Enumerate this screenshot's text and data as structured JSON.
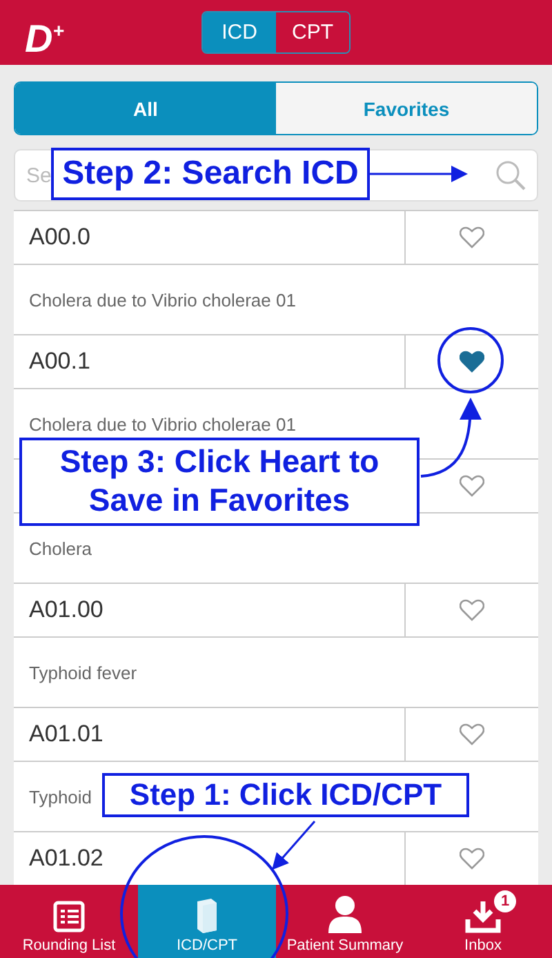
{
  "header": {
    "logo": "D$^{+}$",
    "segments": [
      {
        "label": "ICD",
        "selected": true
      },
      {
        "label": "CPT",
        "selected": false
      }
    ]
  },
  "tabs": [
    {
      "label": "All",
      "selected": true
    },
    {
      "label": "Favorites",
      "selected": false
    }
  ],
  "search": {
    "placeholder": "Se"
  },
  "entries": [
    {
      "code": "A00.0",
      "favorite": false,
      "description": "Cholera due to Vibrio cholerae 01"
    },
    {
      "code": "A00.1",
      "favorite": true,
      "description": "Cholera due to Vibrio cholerae 01"
    },
    {
      "favorite": false,
      "description": "Cholera"
    },
    {
      "code": "A01.00",
      "favorite": false,
      "description": "Typhoid fever"
    },
    {
      "code": "A01.01",
      "favorite": false,
      "description": "Typhoid"
    },
    {
      "code": "A01.02",
      "favorite": false
    }
  ],
  "tab_bar": [
    {
      "label": "Rounding List",
      "kind": "list",
      "selected": false
    },
    {
      "label": "ICD/CPT",
      "kind": "book",
      "selected": true
    },
    {
      "label": "Patient Summary",
      "kind": "person",
      "selected": false
    },
    {
      "label": "Inbox",
      "kind": "download",
      "selected": false,
      "badge": "1"
    }
  ],
  "annotations": [
    "Step 2: Search ICD",
    "Step 3: Click Heart to Save in Favorites",
    "Step 1: Click ICD/CPT"
  ]
}
